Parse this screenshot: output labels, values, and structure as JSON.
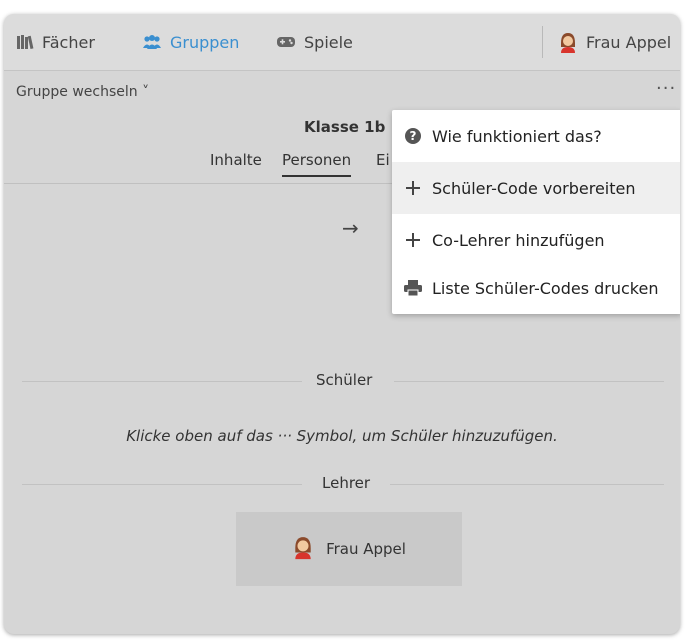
{
  "topbar": {
    "nav": [
      {
        "label": "Fächer",
        "icon": "books-icon"
      },
      {
        "label": "Gruppen",
        "icon": "users-icon",
        "active": true
      },
      {
        "label": "Spiele",
        "icon": "gamepad-icon"
      }
    ],
    "user_name": "Frau Appel"
  },
  "subheader": {
    "group_switch": "Gruppe wechseln ˅",
    "more": "···"
  },
  "class": {
    "title": "Klasse 1b",
    "tabs": [
      "Inhalte",
      "Personen",
      "Ei"
    ]
  },
  "arrow": "→",
  "students": {
    "heading": "Schüler",
    "hint": "Klicke oben auf das ··· Symbol, um Schüler hinzuzufügen."
  },
  "teachers": {
    "heading": "Lehrer",
    "name": "Frau Appel"
  },
  "menu": {
    "items": [
      {
        "label": "Wie funktioniert das?",
        "icon": "question-circle-icon"
      },
      {
        "label": "Schüler-Code vorbereiten",
        "icon": "plus-icon"
      },
      {
        "label": "Co-Lehrer hinzufügen",
        "icon": "plus-icon"
      },
      {
        "label": "Liste Schüler-Codes drucken",
        "icon": "printer-icon"
      }
    ]
  },
  "colors": {
    "accent": "#3a8fd0",
    "background": "#d6d6d6",
    "menu_background": "#ffffff"
  }
}
